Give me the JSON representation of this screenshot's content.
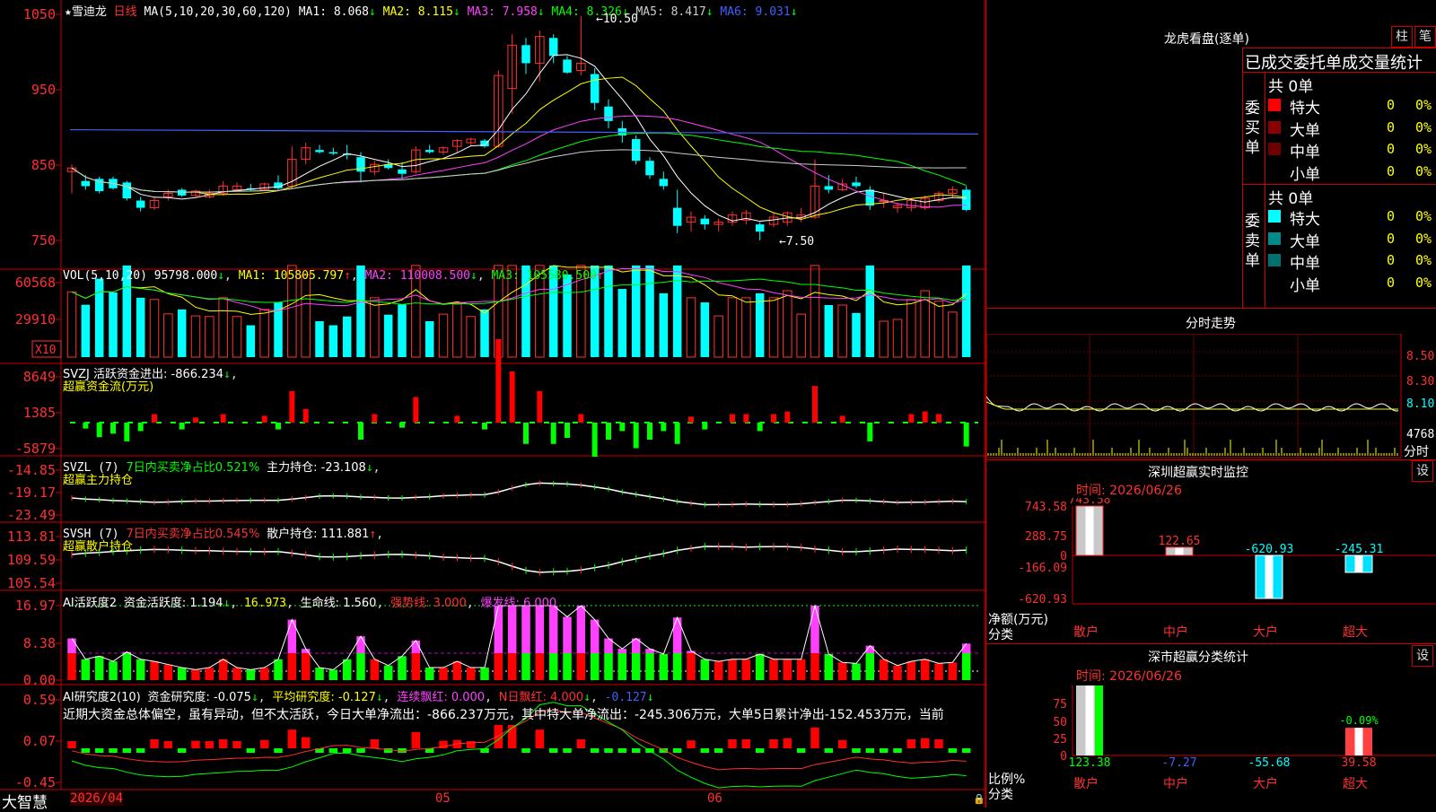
{
  "app": {
    "brand": "大智慧"
  },
  "stock": {
    "name": "雪迪龙",
    "period": "日线",
    "star": "★"
  },
  "main_indicator": {
    "ma_label": "MA(5,10,20,30,60,120)",
    "items": [
      {
        "name": "MA1",
        "value": "MA1: 8.068",
        "arrow": "↓",
        "color": "#ffffff"
      },
      {
        "name": "MA2",
        "value": "MA2: 8.115",
        "arrow": "↓",
        "color": "#ffff00"
      },
      {
        "name": "MA3",
        "value": "MA3: 7.958",
        "arrow": "↓",
        "color": "#ff40ff"
      },
      {
        "name": "MA4",
        "value": "MA4: 8.326",
        "arrow": "↓",
        "color": "#00ff00"
      },
      {
        "name": "MA5",
        "value": "MA5: 8.417",
        "arrow": "↓",
        "color": "#cccccc"
      },
      {
        "name": "MA6",
        "value": "MA6: 9.031",
        "arrow": "↓",
        "color": "#4060ff"
      }
    ],
    "high_label": "10.50",
    "low_label": "7.50",
    "y_ticks": [
      "1050",
      "950",
      "850",
      "750"
    ]
  },
  "vol": {
    "label": "VOL(5,10,20)",
    "value": "95798.000",
    "ma1": "MA1: 105805.797",
    "ma2": "MA2: 110008.500",
    "ma3": "MA3: 105580.500",
    "y_ticks": [
      "60568",
      "29910"
    ],
    "unit": "X10"
  },
  "svzj": {
    "label": "SVZJ  活跃资金进出: -866.234",
    "sub": "超赢资金流(万元)",
    "y_ticks": [
      "8649",
      "1385",
      "-5879"
    ]
  },
  "svzl": {
    "label": "SVZL (7)",
    "ratio": "7日内买卖净占比0.521%",
    "main": "主力持仓: -23.108",
    "sub": "超赢主力持仓",
    "y_ticks": [
      "-14.85",
      "-19.17",
      "-23.49"
    ]
  },
  "svsh": {
    "label": "SVSH (7)",
    "ratio": "7日内买卖净占比0.545%",
    "main": "散户持仓: 111.881",
    "sub": "超赢散户持仓",
    "y_ticks": [
      "113.81",
      "109.59",
      "105.54"
    ]
  },
  "ai_active": {
    "label": "AI活跃度2",
    "a": "资金活跃度: 1.194",
    "b": "16.973",
    "c": "生命线: 1.560",
    "d": "强势线: 3.000",
    "e": "爆发线: 6.000",
    "y_ticks": [
      "16.97",
      "8.38",
      "0.00"
    ]
  },
  "ai_research": {
    "label": "AI研究度2(10)",
    "a": "资金研究度: -0.075",
    "b": "平均研究度: -0.127",
    "c": "连续飘红: 0.000",
    "d": "N日飘红: 4.000",
    "e": "-0.127",
    "desc": "近期大资金总体偏空，虽有异动，但不太活跃，今日大单净流出：-866.237万元，其中特大单净流出：-245.306万元，大单5日累计净出-152.453万元，当前",
    "y_ticks": [
      "0.59",
      "0.07",
      "-0.45"
    ]
  },
  "x_axis": [
    "2026/04",
    "05",
    "06"
  ],
  "dragon": {
    "title": "龙虎看盘(逐单)",
    "btn1": "柱",
    "btn2": "笔",
    "stat_title": "已成交委托单成交量统计",
    "buy_label": "委买单",
    "sell_label": "委卖单",
    "buy_total": "共 0单",
    "sell_total": "共 0单",
    "buy_rows": [
      {
        "name": "特大",
        "count": "0",
        "pct": "0%",
        "color": "#ff0000"
      },
      {
        "name": "大单",
        "count": "0",
        "pct": "0%",
        "color": "#8b0000"
      },
      {
        "name": "中单",
        "count": "0",
        "pct": "0%",
        "color": "#700000"
      },
      {
        "name": "小单",
        "count": "0",
        "pct": "0%",
        "color": ""
      }
    ],
    "sell_rows": [
      {
        "name": "特大",
        "count": "0",
        "pct": "0%",
        "color": "#00ffff"
      },
      {
        "name": "大单",
        "count": "0",
        "pct": "0%",
        "color": "#008b8b"
      },
      {
        "name": "中单",
        "count": "0",
        "pct": "0%",
        "color": "#007070"
      },
      {
        "name": "小单",
        "count": "0",
        "pct": "0%",
        "color": ""
      }
    ]
  },
  "intraday": {
    "title": "分时走势",
    "y_ticks": [
      "8.50",
      "8.30",
      "8.10"
    ],
    "vol_label": "4768",
    "tag": "分时"
  },
  "monitor": {
    "title": "深圳超赢实时监控",
    "btn": "设",
    "time": "时间: 2026/06/26",
    "y_ticks": [
      "743.58",
      "288.75",
      "0",
      "-166.09",
      "-620.93"
    ],
    "unit_label": "净额(万元)",
    "cat_label": "分类",
    "bars": [
      {
        "cat": "散户",
        "value": 743.58,
        "label": "743.58"
      },
      {
        "cat": "中户",
        "value": 122.65,
        "label": "122.65"
      },
      {
        "cat": "大户",
        "value": -620.93,
        "label": "-620.93"
      },
      {
        "cat": "超大",
        "value": -245.31,
        "label": "-245.31"
      }
    ]
  },
  "classify": {
    "title": "深市超赢分类统计",
    "btn": "设",
    "time": "时间: 2026/06/26",
    "y_ticks": [
      "75",
      "50",
      "25",
      "0"
    ],
    "unit_label": "比例%",
    "cat_label": "分类",
    "bars": [
      {
        "cat": "散户",
        "value": 123.38,
        "label": "123.38"
      },
      {
        "cat": "中户",
        "value": -7.27,
        "label": "-7.27"
      },
      {
        "cat": "大户",
        "value": -55.68,
        "label": "-55.68"
      },
      {
        "cat": "超大",
        "value": 39.58,
        "label": "39.58",
        "top_label": "-0.09%"
      }
    ]
  },
  "chart_data": {
    "type": "candlestick",
    "ylim": [
      7.2,
      10.7
    ],
    "ohlc": [
      [
        8.45,
        8.55,
        8.15,
        8.5
      ],
      [
        8.32,
        8.4,
        8.2,
        8.25
      ],
      [
        8.35,
        8.38,
        8.15,
        8.18
      ],
      [
        8.35,
        8.38,
        8.2,
        8.22
      ],
      [
        8.3,
        8.32,
        8.05,
        8.08
      ],
      [
        8.05,
        8.1,
        7.9,
        7.95
      ],
      [
        7.95,
        8.1,
        7.92,
        8.05
      ],
      [
        8.1,
        8.2,
        8.05,
        8.15
      ],
      [
        8.2,
        8.22,
        8.1,
        8.12
      ],
      [
        8.12,
        8.2,
        8.1,
        8.18
      ],
      [
        8.1,
        8.2,
        8.08,
        8.15
      ],
      [
        8.15,
        8.32,
        8.12,
        8.25
      ],
      [
        8.2,
        8.3,
        8.18,
        8.25
      ],
      [
        8.22,
        8.28,
        8.18,
        8.2
      ],
      [
        8.2,
        8.3,
        8.18,
        8.28
      ],
      [
        8.3,
        8.4,
        8.2,
        8.22
      ],
      [
        8.25,
        8.8,
        8.22,
        8.62
      ],
      [
        8.62,
        8.85,
        8.55,
        8.78
      ],
      [
        8.75,
        8.82,
        8.7,
        8.72
      ],
      [
        8.72,
        8.78,
        8.68,
        8.7
      ],
      [
        8.7,
        8.82,
        8.62,
        8.68
      ],
      [
        8.65,
        8.72,
        8.3,
        8.45
      ],
      [
        8.45,
        8.6,
        8.4,
        8.55
      ],
      [
        8.55,
        8.62,
        8.48,
        8.5
      ],
      [
        8.48,
        8.58,
        8.35,
        8.42
      ],
      [
        8.45,
        8.8,
        8.42,
        8.75
      ],
      [
        8.75,
        8.82,
        8.7,
        8.72
      ],
      [
        8.72,
        8.8,
        8.68,
        8.78
      ],
      [
        8.8,
        8.9,
        8.72,
        8.88
      ],
      [
        8.85,
        8.92,
        8.8,
        8.9
      ],
      [
        8.88,
        8.9,
        8.78,
        8.8
      ],
      [
        8.8,
        9.85,
        8.78,
        9.78
      ],
      [
        9.6,
        10.35,
        9.25,
        10.2
      ],
      [
        10.2,
        10.3,
        9.8,
        9.95
      ],
      [
        9.95,
        10.4,
        9.7,
        10.32
      ],
      [
        10.3,
        10.35,
        9.95,
        10.05
      ],
      [
        10.0,
        10.05,
        9.8,
        9.82
      ],
      [
        9.85,
        10.6,
        9.78,
        9.95
      ],
      [
        9.8,
        9.88,
        9.3,
        9.4
      ],
      [
        9.35,
        9.45,
        9.05,
        9.15
      ],
      [
        9.05,
        9.15,
        8.85,
        8.95
      ],
      [
        8.9,
        8.95,
        8.55,
        8.6
      ],
      [
        8.6,
        8.65,
        8.35,
        8.4
      ],
      [
        8.35,
        8.45,
        8.2,
        8.25
      ],
      [
        7.95,
        8.2,
        7.6,
        7.7
      ],
      [
        7.75,
        7.9,
        7.62,
        7.82
      ],
      [
        7.8,
        7.85,
        7.65,
        7.72
      ],
      [
        7.72,
        7.8,
        7.62,
        7.75
      ],
      [
        7.75,
        7.9,
        7.7,
        7.85
      ],
      [
        7.78,
        7.92,
        7.72,
        7.88
      ],
      [
        7.72,
        7.75,
        7.5,
        7.62
      ],
      [
        7.72,
        7.88,
        7.68,
        7.82
      ],
      [
        7.75,
        7.9,
        7.7,
        7.88
      ],
      [
        7.82,
        7.95,
        7.75,
        7.85
      ],
      [
        7.82,
        8.62,
        7.8,
        8.25
      ],
      [
        8.25,
        8.4,
        8.15,
        8.2
      ],
      [
        8.2,
        8.35,
        8.18,
        8.28
      ],
      [
        8.3,
        8.38,
        8.22,
        8.25
      ],
      [
        8.2,
        8.25,
        7.92,
        7.98
      ],
      [
        8.05,
        8.15,
        7.95,
        8.05
      ],
      [
        7.95,
        8.02,
        7.88,
        7.98
      ],
      [
        7.95,
        8.08,
        7.9,
        8.05
      ],
      [
        7.95,
        8.12,
        7.92,
        8.08
      ],
      [
        8.05,
        8.18,
        8.02,
        8.15
      ],
      [
        8.15,
        8.25,
        8.08,
        8.2
      ],
      [
        8.2,
        8.25,
        7.9,
        7.92
      ]
    ]
  }
}
